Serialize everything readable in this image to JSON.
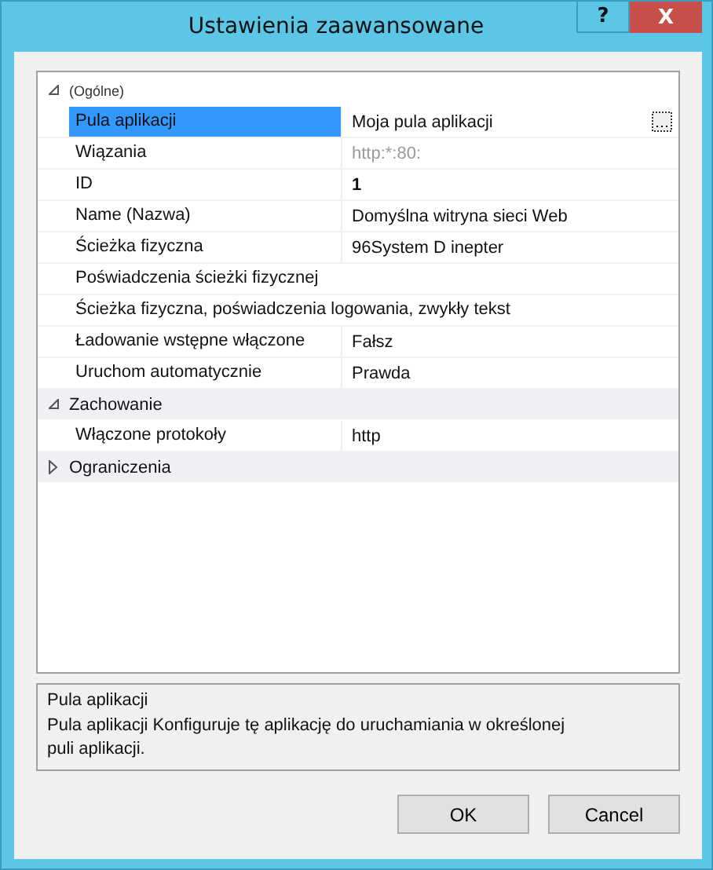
{
  "window": {
    "title": "Ustawienia zaawansowane",
    "help_button": "?",
    "close_button": "X"
  },
  "property_grid": {
    "categories": [
      {
        "label": "(Ogólne)",
        "expanded": true,
        "properties": [
          {
            "name": "Pula aplikacji",
            "value": "Moja pula aplikacji",
            "selected": true,
            "disabled": false,
            "bold": false,
            "has_ellipsis_button": true
          },
          {
            "name": "Wiązania",
            "value": "http:*:80:",
            "selected": false,
            "disabled": true,
            "bold": false,
            "has_ellipsis_button": false
          },
          {
            "name": "ID",
            "value": "1",
            "selected": false,
            "disabled": false,
            "bold": true,
            "has_ellipsis_button": false
          },
          {
            "name": "Name (Nazwa)",
            "value": "Domyślna witryna sieci Web",
            "selected": false,
            "disabled": false,
            "bold": false,
            "has_ellipsis_button": false
          },
          {
            "name": "Ścieżka fizyczna",
            "value": "96System D inepter",
            "selected": false,
            "disabled": false,
            "bold": false,
            "has_ellipsis_button": false
          },
          {
            "name": "Poświadczenia ścieżki fizycznej",
            "selected": false,
            "has_ellipsis_button": false
          },
          {
            "name": "Ścieżka fizyczna, poświadczenia logowania, zwykły tekst",
            "selected": false,
            "has_ellipsis_button": false
          },
          {
            "name": "Ładowanie wstępne włączone",
            "value": "Fałsz",
            "selected": false,
            "disabled": false,
            "bold": false,
            "has_ellipsis_button": false
          },
          {
            "name": "Uruchom automatycznie",
            "value": "Prawda",
            "selected": false,
            "disabled": false,
            "bold": false,
            "has_ellipsis_button": false
          }
        ]
      },
      {
        "label": "Zachowanie",
        "expanded": true,
        "properties": [
          {
            "name": "Włączone protokoły",
            "value": "http",
            "selected": false,
            "disabled": false,
            "bold": false,
            "has_ellipsis_button": false
          }
        ]
      },
      {
        "label": "Ograniczenia",
        "expanded": false
      }
    ]
  },
  "description": {
    "title": "Pula aplikacji",
    "text": "Pula aplikacji Konfiguruje tę aplikację do uruchamiania w określonej puli aplikacji."
  },
  "buttons": [
    {
      "label": "OK"
    },
    {
      "label": "Cancel"
    }
  ]
}
